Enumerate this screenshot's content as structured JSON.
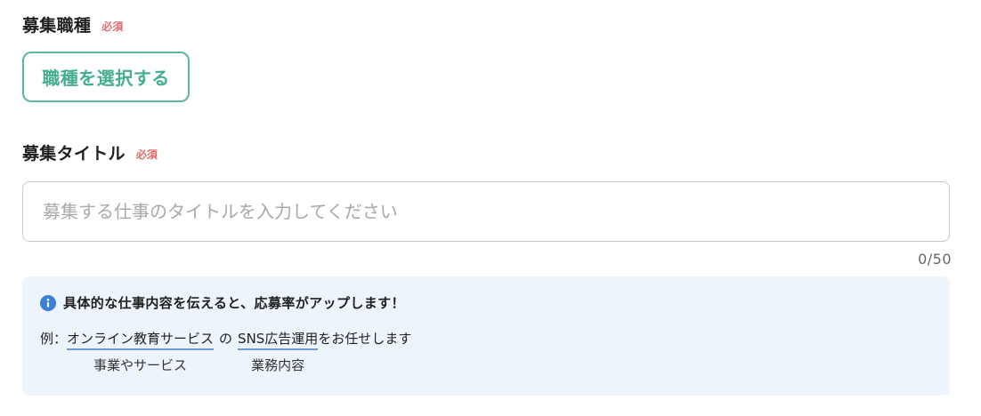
{
  "job_type": {
    "label": "募集職種",
    "required_badge": "必須",
    "select_button_label": "職種を選択する"
  },
  "job_title": {
    "label": "募集タイトル",
    "required_badge": "必須",
    "input_value": "",
    "input_placeholder": "募集する仕事のタイトルを入力してください",
    "char_counter": "0/50"
  },
  "tip": {
    "icon": "info-icon",
    "heading": "具体的な仕事内容を伝えると、応募率がアップします！",
    "example_prefix": "例：",
    "example_business": "オンライン教育サービス",
    "example_connector": "の",
    "example_task": "SNS広告運用",
    "example_suffix": "をお任せします",
    "caption_business": "事業やサービス",
    "caption_task": "業務内容"
  },
  "colors": {
    "accent_green": "#44ad92",
    "required_red": "#e06b6b",
    "info_blue": "#3c7fd8",
    "tip_background": "#edf4fc"
  }
}
